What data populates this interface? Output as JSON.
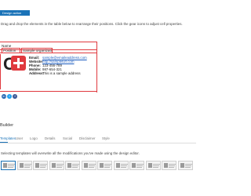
{
  "toolbar": {
    "design_button": "Design action"
  },
  "hint": "Drag and drop the elements in the table below to rearrange their positions. Click the gear icons to adjust cell properties.",
  "signature": {
    "name": "Name",
    "position": "Position",
    "organization": "Sample organization",
    "logo": "C+",
    "fields": [
      {
        "label": "Email:",
        "value": "sample@emaileaddress.com",
        "link": true
      },
      {
        "label": "Website:",
        "value": "http://samplelurl.com",
        "link": true
      },
      {
        "label": "Phone:",
        "value": "123-456-789",
        "link": false
      },
      {
        "label": "Mobile:",
        "value": "987-654-321",
        "link": false
      },
      {
        "label": "Address:",
        "value": "This is a sample address",
        "link": false
      }
    ],
    "socials": [
      {
        "name": "linkedin-icon",
        "glyph": "in",
        "color": "#2867b2"
      },
      {
        "name": "twitter-icon",
        "glyph": "t",
        "color": "#1da1f2"
      },
      {
        "name": "facebook-icon",
        "glyph": "f",
        "color": "#3b5998"
      }
    ]
  },
  "builder": {
    "title": "Builder",
    "tabs": [
      "Templates",
      "User",
      "Logo",
      "Details",
      "Social",
      "Disclaimer",
      "Style"
    ],
    "template_hint": "Selecting templates will overwrite all the modifications you've made using the design editor.",
    "thumbnail_count": 12
  },
  "colors": {
    "accent": "#1a73b8",
    "signature_red": "#e0393e"
  }
}
